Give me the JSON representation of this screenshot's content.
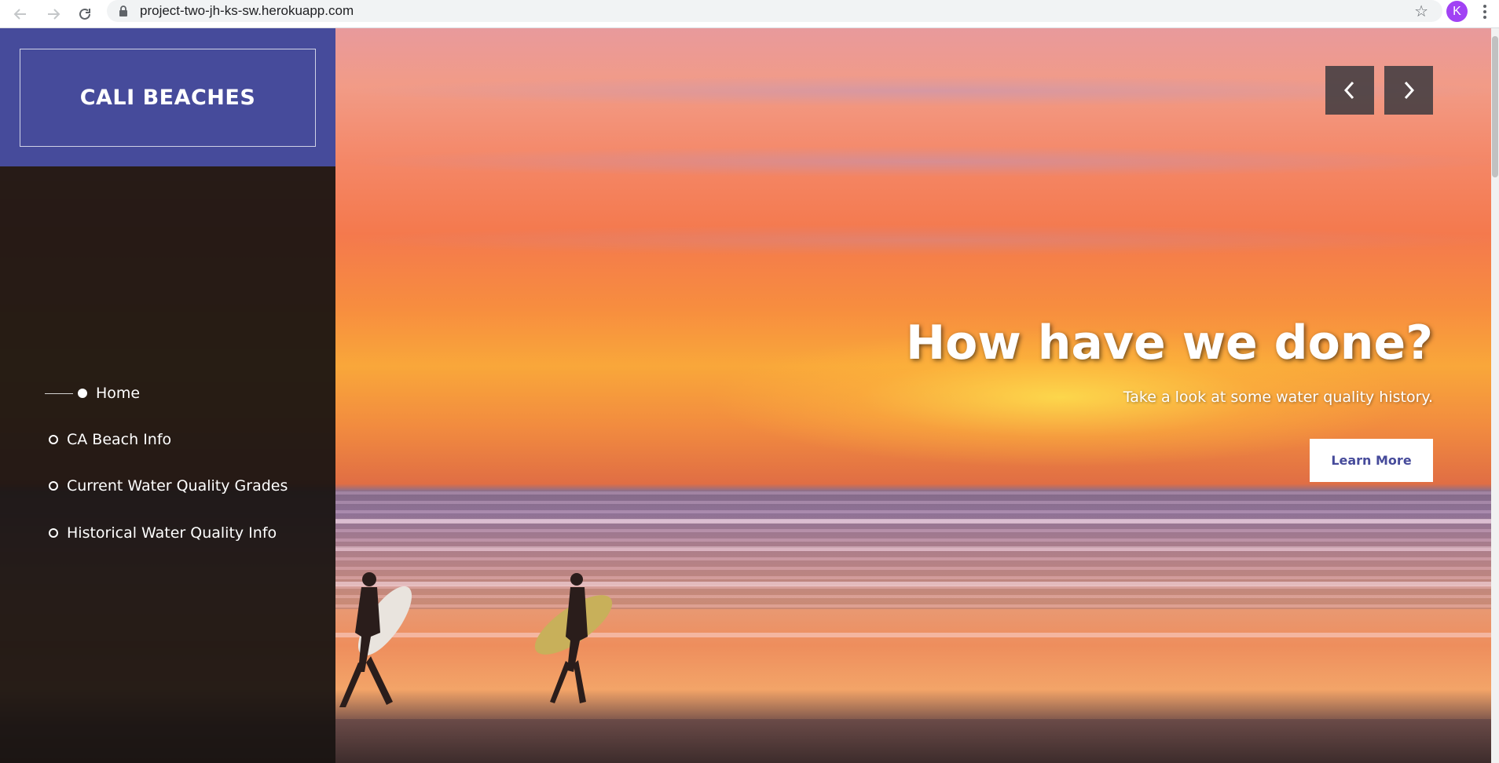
{
  "browser": {
    "url": "project-two-jh-ks-sw.herokuapp.com",
    "avatar_letter": "K",
    "icons": {
      "back": "arrow-left-icon",
      "forward": "arrow-right-icon",
      "reload": "reload-icon",
      "lock": "lock-icon",
      "bookmark": "star-icon",
      "menu": "kebab-menu-icon"
    }
  },
  "sidebar": {
    "brand": "CALI BEACHES",
    "brand_color": "#464b9b",
    "items": [
      {
        "label": "Home",
        "active": true
      },
      {
        "label": "CA Beach Info",
        "active": false
      },
      {
        "label": "Current Water Quality Grades",
        "active": false
      },
      {
        "label": "Historical Water Quality Info",
        "active": false
      }
    ]
  },
  "hero": {
    "heading": "How have we done?",
    "subtitle": "Take a look at some water quality history.",
    "cta_label": "Learn More",
    "prev_icon": "chevron-left-icon",
    "next_icon": "chevron-right-icon"
  }
}
